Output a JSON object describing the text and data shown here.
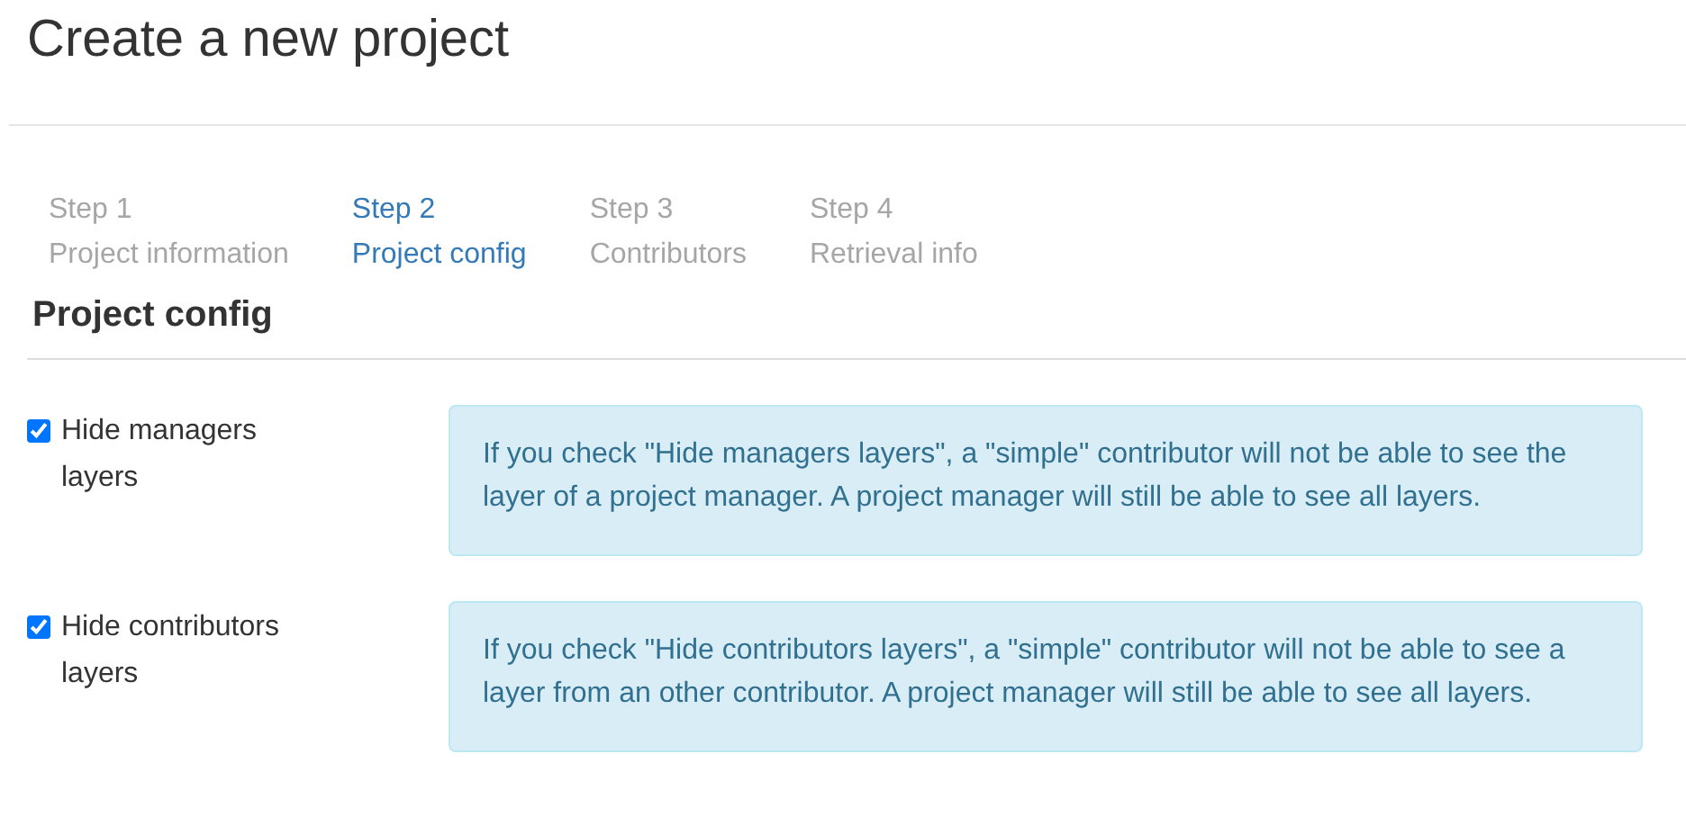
{
  "page_title": "Create a new project",
  "steps": [
    {
      "number": "Step 1",
      "name": "Project information",
      "selected": false
    },
    {
      "number": "Step 2",
      "name": "Project config",
      "selected": true
    },
    {
      "number": "Step 3",
      "name": "Contributors",
      "selected": false
    },
    {
      "number": "Step 4",
      "name": "Retrieval info",
      "selected": false
    }
  ],
  "section_title": "Project config",
  "options": [
    {
      "label": "Hide managers layers",
      "checked": true,
      "help": "If you check \"Hide managers layers\", a \"simple\" contributor will not be able to see the layer of a project manager. A project manager will still be able to see all layers."
    },
    {
      "label": "Hide contributors layers",
      "checked": true,
      "help": "If you check \"Hide contributors layers\", a \"simple\" contributor will not be able to see a layer from an other contributor. A project manager will still be able to see all layers."
    }
  ]
}
